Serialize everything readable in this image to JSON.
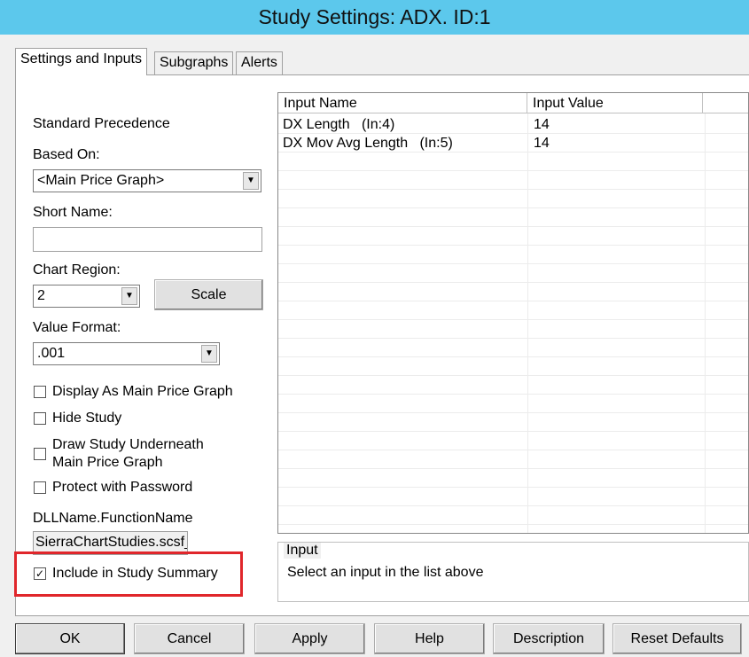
{
  "window": {
    "title": "Study Settings: ADX. ID:1"
  },
  "tabs": [
    {
      "label": "Settings and Inputs",
      "active": true
    },
    {
      "label": "Subgraphs",
      "active": false
    },
    {
      "label": "Alerts",
      "active": false
    }
  ],
  "settings": {
    "precedence_label": "Standard Precedence",
    "based_on_label": "Based On:",
    "based_on_value": "<Main Price Graph>",
    "short_name_label": "Short Name:",
    "short_name_value": "",
    "chart_region_label": "Chart Region:",
    "chart_region_value": "2",
    "scale_button": "Scale",
    "value_format_label": "Value Format:",
    "value_format_value": ".001",
    "checkboxes": [
      {
        "label": "Display As Main Price Graph",
        "checked": false
      },
      {
        "label": "Hide Study",
        "checked": false
      },
      {
        "label": "Draw Study Underneath",
        "label2": "Main Price Graph",
        "checked": false
      },
      {
        "label": "Protect with Password",
        "checked": false
      },
      {
        "label": "Include in Study Summary",
        "checked": true
      }
    ],
    "dll_label": "DLLName.FunctionName",
    "dll_value": "SierraChartStudies.scsf_ADX"
  },
  "inputs_table": {
    "columns": [
      "Input Name",
      "Input Value"
    ],
    "rows": [
      {
        "name": "DX Length   (In:4)",
        "value": "14"
      },
      {
        "name": "DX Mov Avg Length   (In:5)",
        "value": "14"
      }
    ]
  },
  "input_group": {
    "title": "Input",
    "message": "Select an input in the list above"
  },
  "buttons": {
    "ok": "OK",
    "cancel": "Cancel",
    "apply": "Apply",
    "help": "Help",
    "description": "Description",
    "reset_defaults": "Reset Defaults"
  },
  "colors": {
    "titlebar": "#5cc8ec",
    "highlight": "#e0262b"
  },
  "icons": {
    "dropdown": "chevron-down-icon",
    "checkmark": "checkmark-icon"
  }
}
